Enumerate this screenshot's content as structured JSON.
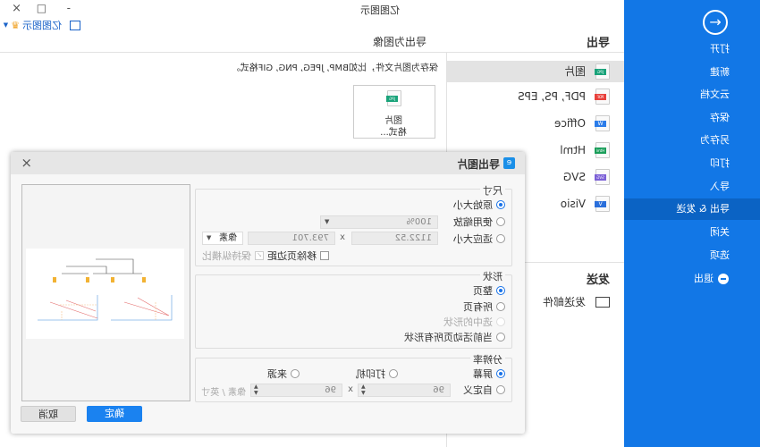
{
  "window": {
    "title": "亿图图示",
    "brand": "亿图图示",
    "controls": {
      "close": "×",
      "maximize": "□",
      "minimize": "-"
    }
  },
  "sidebar": {
    "items": [
      {
        "label": "打开"
      },
      {
        "label": "新建"
      },
      {
        "label": "云文档"
      },
      {
        "label": "保存"
      },
      {
        "label": "另存为"
      },
      {
        "label": "打印"
      },
      {
        "label": "导入"
      },
      {
        "label": "导出 & 发送",
        "active": true
      },
      {
        "label": "关闭"
      },
      {
        "label": "选项"
      },
      {
        "label": "退出"
      }
    ],
    "accent": "#1277e6"
  },
  "export": {
    "heading": "导出",
    "formats": [
      {
        "label": "图片",
        "badge": "JPG",
        "color": "#1aa37a",
        "active": true
      },
      {
        "label": "PDF, PS, EPS",
        "badge": "PDF",
        "color": "#e8413c"
      },
      {
        "label": "Office",
        "badge": "W",
        "color": "#2b7ce9"
      },
      {
        "label": "Html",
        "badge": "Html",
        "color": "#1a9e5a"
      },
      {
        "label": "SVG",
        "badge": "SVG",
        "color": "#7b5fd6"
      },
      {
        "label": "Visio",
        "badge": "V",
        "color": "#2a6fdb"
      }
    ]
  },
  "send": {
    "heading": "发送",
    "items": [
      {
        "label": "发送邮件"
      }
    ]
  },
  "content": {
    "title": "导出为图像",
    "description": "保存为图片文件，比如BMP, JPEG, PNG, GIF格式。",
    "card": {
      "badge": "JPG",
      "line1": "图片",
      "line2": "格式..."
    }
  },
  "dialog": {
    "title": "导出图片",
    "size": {
      "title": "尺寸",
      "original": "原始大小",
      "scale": "使用缩放",
      "fit": "适应大小",
      "scale_value": "100%",
      "width": "1122.52",
      "x": "x",
      "height": "793.701",
      "unit": "像素",
      "remove_margin": "移除页边距",
      "keep_ratio": "保持纵横比",
      "selected": "original"
    },
    "shape": {
      "title": "形状",
      "options": [
        "整页",
        "所有页",
        "选中的形状",
        "当前活动页所有形状"
      ],
      "selected": "整页"
    },
    "resolution": {
      "title": "分辨率",
      "screen": "屏幕",
      "printer": "打印机",
      "source": "来源",
      "custom": "自定义",
      "dpi_x": "96",
      "x": "x",
      "dpi_y": "96",
      "unit": "像素 / 英寸",
      "selected": "screen"
    },
    "ok": "确定",
    "cancel": "取消"
  }
}
